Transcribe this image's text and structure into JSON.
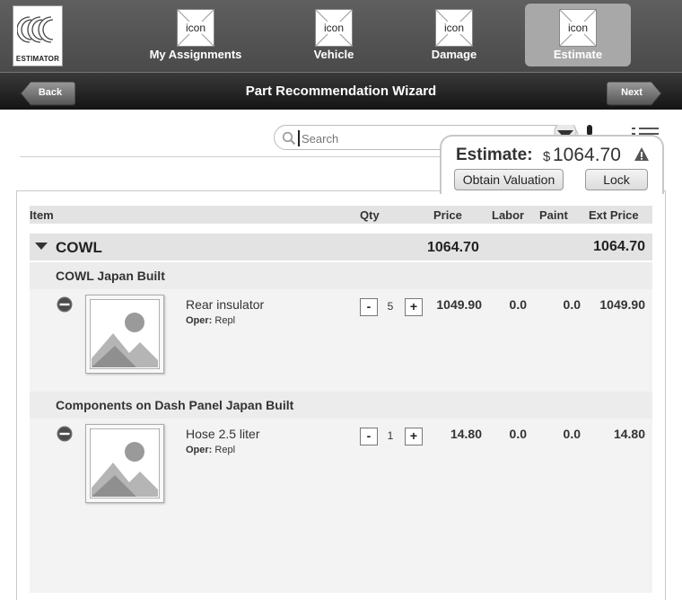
{
  "logo": {
    "text": "ESTIMATOR"
  },
  "nav": {
    "tabs": [
      {
        "placeholder": "icon",
        "label": "My Assignments",
        "active": false
      },
      {
        "placeholder": "icon",
        "label": "Vehicle",
        "active": false
      },
      {
        "placeholder": "icon",
        "label": "Damage",
        "active": false
      },
      {
        "placeholder": "icon",
        "label": "Estimate",
        "active": true
      }
    ]
  },
  "titlebar": {
    "back_label": "Back",
    "title": "Part Recommendation Wizard",
    "next_label": "Next"
  },
  "search": {
    "placeholder": "Search",
    "value": ""
  },
  "estimate": {
    "label": "Estimate:",
    "currency": "$",
    "amount": "1064.70",
    "valuation_label": "Obtain Valuation",
    "lock_label": "Lock"
  },
  "table": {
    "columns": {
      "item": "Item",
      "qty": "Qty",
      "price": "Price",
      "labor": "Labor",
      "paint": "Paint",
      "ext_price": "Ext Price"
    },
    "group": {
      "name": "COWL",
      "price": "1064.70",
      "ext_price": "1064.70"
    },
    "sections": [
      {
        "title": "COWL Japan Built",
        "part": {
          "name": "Rear insulator",
          "oper_label": "Oper:",
          "oper_value": "Repl",
          "minus": "-",
          "qty": "5",
          "plus": "+",
          "price": "1049.90",
          "labor": "0.0",
          "paint": "0.0",
          "ext_price": "1049.90"
        }
      },
      {
        "title": "Components on Dash Panel Japan Built",
        "part": {
          "name": "Hose 2.5 liter",
          "oper_label": "Oper:",
          "oper_value": "Repl",
          "minus": "-",
          "qty": "1",
          "plus": "+",
          "price": "14.80",
          "labor": "0.0",
          "paint": "0.0",
          "ext_price": "14.80"
        }
      }
    ]
  }
}
